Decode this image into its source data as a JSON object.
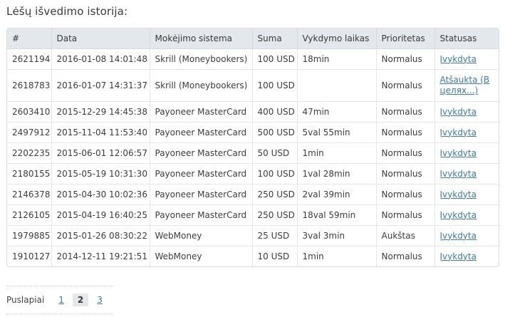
{
  "title": "Lėšų išvedimo istorija:",
  "table": {
    "headers": [
      "#",
      "Data",
      "Mokėjimo sistema",
      "Suma",
      "Vykdymo laikas",
      "Prioritetas",
      "Statusas"
    ],
    "rows": [
      {
        "id": "2621194",
        "date": "2016-01-08 14:01:48",
        "system": "Skrill (Moneybookers)",
        "amount": "100 USD",
        "duration": "18min",
        "priority": "Normalus",
        "status": "Įvykdyta"
      },
      {
        "id": "2618783",
        "date": "2016-01-07 14:31:37",
        "system": "Skrill (Moneybookers)",
        "amount": "100 USD",
        "duration": "",
        "priority": "Normalus",
        "status": "Atšaukta (В целях...)"
      },
      {
        "id": "2603410",
        "date": "2015-12-29 14:45:38",
        "system": "Payoneer MasterCard",
        "amount": "400 USD",
        "duration": "47min",
        "priority": "Normalus",
        "status": "Įvykdyta"
      },
      {
        "id": "2497912",
        "date": "2015-11-04 11:53:40",
        "system": "Payoneer MasterCard",
        "amount": "500 USD",
        "duration": "5val 55min",
        "priority": "Normalus",
        "status": "Įvykdyta"
      },
      {
        "id": "2202235",
        "date": "2015-06-01 12:06:57",
        "system": "Payoneer MasterCard",
        "amount": "50 USD",
        "duration": "1min",
        "priority": "Normalus",
        "status": "Įvykdyta"
      },
      {
        "id": "2180155",
        "date": "2015-05-19 10:31:30",
        "system": "Payoneer MasterCard",
        "amount": "100 USD",
        "duration": "1val 28min",
        "priority": "Normalus",
        "status": "Įvykdyta"
      },
      {
        "id": "2146378",
        "date": "2015-04-30 10:02:36",
        "system": "Payoneer MasterCard",
        "amount": "250 USD",
        "duration": "2val 39min",
        "priority": "Normalus",
        "status": "Įvykdyta"
      },
      {
        "id": "2126105",
        "date": "2015-04-19 16:40:25",
        "system": "Payoneer MasterCard",
        "amount": "250 USD",
        "duration": "18val 59min",
        "priority": "Normalus",
        "status": "Įvykdyta"
      },
      {
        "id": "1979885",
        "date": "2015-01-26 08:30:22",
        "system": "WebMoney",
        "amount": "25 USD",
        "duration": "3val 3min",
        "priority": "Aukštas",
        "status": "Įvykdyta"
      },
      {
        "id": "1910127",
        "date": "2014-12-11 19:21:51",
        "system": "WebMoney",
        "amount": "10 USD",
        "duration": "1min",
        "priority": "Normalus",
        "status": "Įvykdyta"
      }
    ]
  },
  "pagination": {
    "label": "Puslapiai",
    "pages": [
      "1",
      "2",
      "3"
    ],
    "current": "2"
  },
  "colors": {
    "link": "#3e7aa3",
    "header_bg": "#e3e8ec",
    "border": "#d6dbe0"
  }
}
